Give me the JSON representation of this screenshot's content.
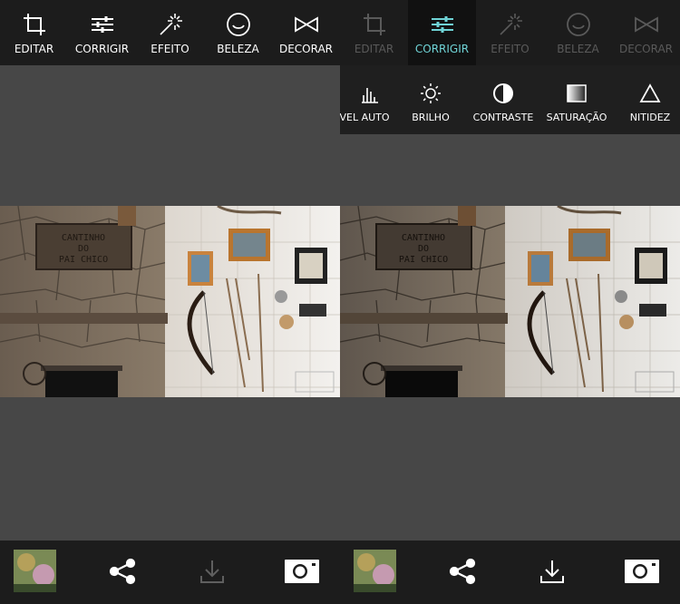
{
  "left": {
    "tabs": [
      {
        "label": "EDITAR",
        "icon": "crop-icon"
      },
      {
        "label": "CORRIGIR",
        "icon": "sliders-icon"
      },
      {
        "label": "EFEITO",
        "icon": "magic-wand-icon"
      },
      {
        "label": "BELEZA",
        "icon": "smile-icon"
      },
      {
        "label": "DECORAR",
        "icon": "bowtie-icon"
      }
    ]
  },
  "right": {
    "tabs": [
      {
        "label": "EDITAR",
        "icon": "crop-icon",
        "state": "dimmed"
      },
      {
        "label": "CORRIGIR",
        "icon": "sliders-icon",
        "state": "active"
      },
      {
        "label": "EFEITO",
        "icon": "magic-wand-icon",
        "state": "dimmed"
      },
      {
        "label": "BELEZA",
        "icon": "smile-icon",
        "state": "dimmed"
      },
      {
        "label": "DECORAR",
        "icon": "bowtie-icon",
        "state": "dimmed"
      }
    ],
    "adjust_tools": [
      {
        "label": "VEL AUTO",
        "icon": "levels-icon"
      },
      {
        "label": "BRILHO",
        "icon": "sun-icon"
      },
      {
        "label": "CONTRASTE",
        "icon": "contrast-icon"
      },
      {
        "label": "SATURAÇÃO",
        "icon": "gradient-square-icon"
      },
      {
        "label": "NITIDEZ",
        "icon": "triangle-icon"
      }
    ]
  },
  "photo": {
    "sign_lines": [
      "CANTINHO",
      "DO",
      "PAI CHICO"
    ]
  },
  "bottom_icons": [
    "gallery-thumbnail",
    "share-icon",
    "download-icon",
    "camera-icon"
  ],
  "colors": {
    "accent": "#6fd3d6",
    "bar": "#1c1c1c",
    "background": "#474747"
  }
}
